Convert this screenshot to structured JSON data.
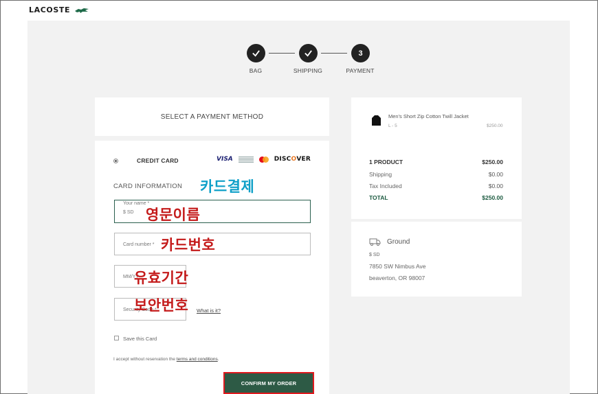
{
  "brand": {
    "name": "LACOSTE"
  },
  "stepper": {
    "steps": [
      {
        "label": "BAG",
        "state": "done"
      },
      {
        "label": "SHIPPING",
        "state": "done"
      },
      {
        "label": "PAYMENT",
        "number": "3",
        "state": "current"
      }
    ]
  },
  "payment": {
    "title": "SELECT A PAYMENT METHOD",
    "method_label": "CREDIT CARD",
    "card_logos": {
      "visa": "VISA",
      "discover_pre": "DISC",
      "discover_o": "O",
      "discover_post": "VER"
    },
    "card_info_label": "CARD INFORMATION",
    "name_field": {
      "label": "Your name *",
      "value": "$ SD"
    },
    "card_number_placeholder": "Card number *",
    "expiry_placeholder": "MM/YY",
    "security_placeholder": "Security Code *",
    "help_link": "What is it?",
    "save_label": "Save this Card",
    "terms_prefix": "I accept without reservation the ",
    "terms_link": "terms and conditions",
    "terms_suffix": ".",
    "confirm_label": "CONFIRM MY ORDER"
  },
  "annotations": {
    "card_payment": "카드결제",
    "english_name": "영문이름",
    "card_number": "카드번호",
    "expiry": "유효기간",
    "security_code": "보안번호"
  },
  "summary": {
    "product": {
      "name": "Men's Short Zip Cotton Twill Jacket",
      "size": "L - 5",
      "price": "$250.00"
    },
    "rows": [
      {
        "label": "1 PRODUCT",
        "value": "$250.00"
      },
      {
        "label": "Shipping",
        "value": "$0.00"
      },
      {
        "label": "Tax Included",
        "value": "$0.00"
      },
      {
        "label": "TOTAL",
        "value": "$250.00"
      }
    ],
    "shipping": {
      "method": "Ground",
      "name": "$ SD",
      "address_line1": "7850 SW Nimbus Ave",
      "address_line2": "beaverton, OR 98007"
    }
  },
  "colors": {
    "accent_green": "#2d5a45",
    "annotation_red": "#c41a1a",
    "annotation_blue": "#0fa0c8",
    "highlight_border": "#e0191e"
  },
  "icons": [
    "crocodile-logo-icon",
    "check-icon",
    "radio-icon",
    "visa-icon",
    "amex-icon",
    "mastercard-icon",
    "discover-icon",
    "jacket-icon",
    "truck-icon",
    "checkbox-icon"
  ]
}
